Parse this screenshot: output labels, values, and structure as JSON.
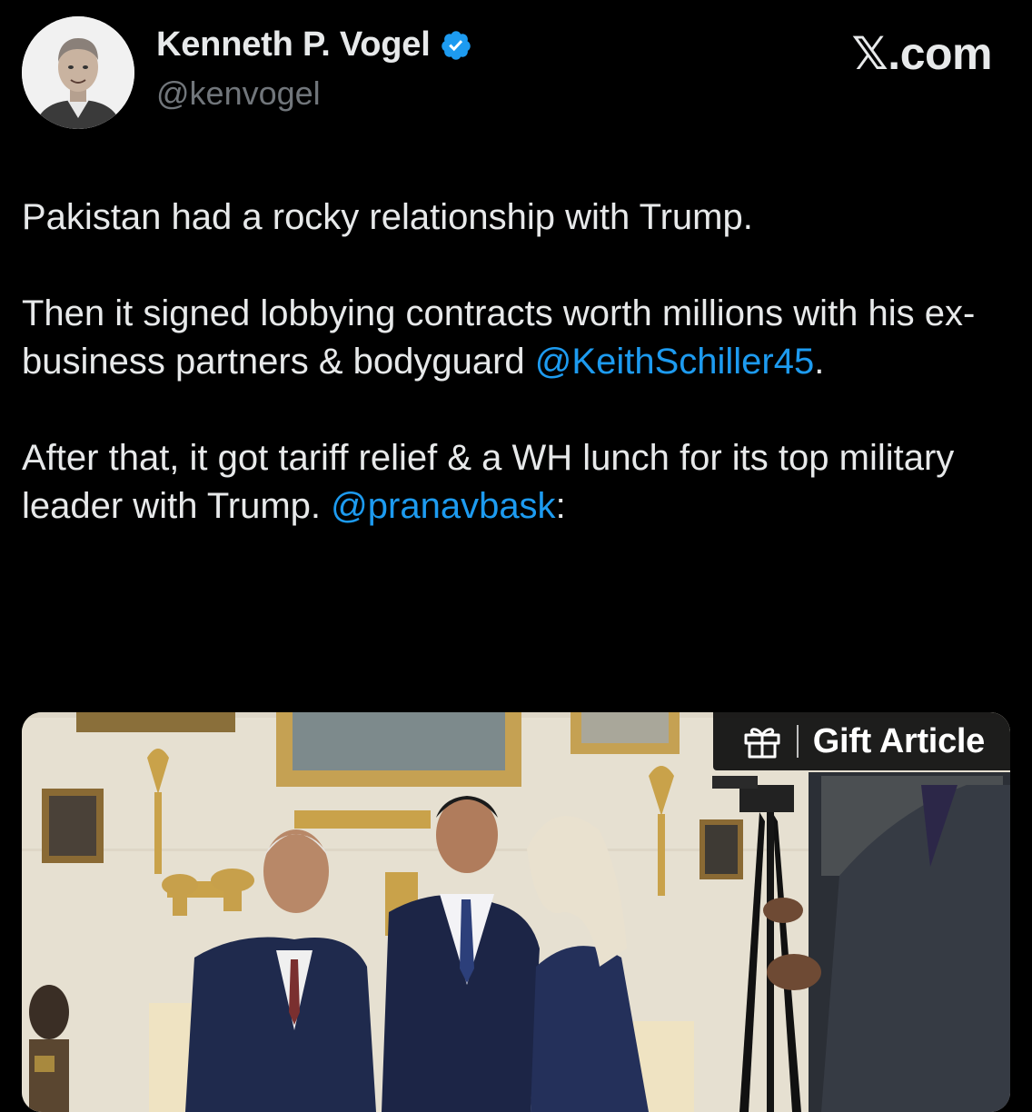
{
  "author": {
    "display_name": "Kenneth P. Vogel",
    "handle": "@kenvogel",
    "verified": true,
    "avatar_icon": "profile-photo"
  },
  "site": {
    "mark": "𝕏.com"
  },
  "tweet": {
    "p1": "Pakistan had a rocky relationship with Trump.",
    "p2_text": "Then it signed lobbying contracts worth millions with his ex-business partners & bodyguard",
    "p2_mention": "@KeithSchiller45",
    "p2_tail": ".",
    "p3_text": "After that, it got tariff relief & a WH lunch for its top military leader with Trump.",
    "p3_mention": "@pranavbask",
    "p3_tail": ":"
  },
  "media": {
    "overlay_label": "Gift Article",
    "overlay_icon": "gift-icon"
  },
  "colors": {
    "background": "#000000",
    "text": "#e7e9ea",
    "secondary_text": "#71767b",
    "link": "#1d9bf0",
    "verified_badge": "#1d9bf0"
  }
}
